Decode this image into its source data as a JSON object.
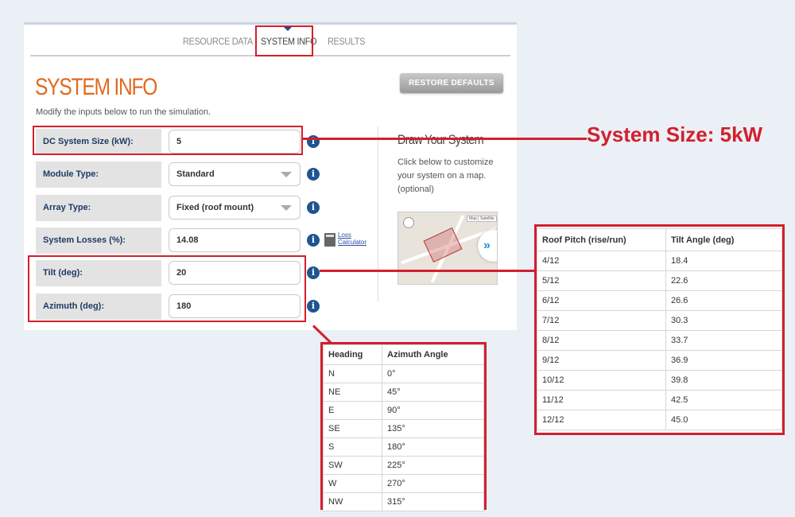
{
  "tabs": [
    "RESOURCE DATA",
    "SYSTEM INFO",
    "RESULTS"
  ],
  "title": "SYSTEM INFO",
  "subtitle": "Modify the inputs below to run the simulation.",
  "restore_button": "RESTORE DEFAULTS",
  "fields": {
    "dc_size": {
      "label": "DC System Size (kW):",
      "value": "5"
    },
    "module_type": {
      "label": "Module Type:",
      "value": "Standard"
    },
    "array_type": {
      "label": "Array Type:",
      "value": "Fixed (roof mount)"
    },
    "losses": {
      "label": "System Losses (%):",
      "value": "14.08"
    },
    "tilt": {
      "label": "Tilt (deg):",
      "value": "20"
    },
    "azimuth": {
      "label": "Azimuth (deg):",
      "value": "180"
    }
  },
  "info_glyph": "i",
  "loss_calc": {
    "line1": "Loss",
    "line2": "Calculator"
  },
  "draw": {
    "title": "Draw Your System",
    "desc": "Click below to customize your system on a map. (optional)",
    "map_pills": [
      "Map",
      "Satellite"
    ],
    "map_arrow": "»"
  },
  "callout": "System Size: 5kW",
  "azimuth_table": {
    "headers": [
      "Heading",
      "Azimuth Angle"
    ],
    "rows": [
      [
        "N",
        "0°"
      ],
      [
        "NE",
        "45°"
      ],
      [
        "E",
        "90°"
      ],
      [
        "SE",
        "135°"
      ],
      [
        "S",
        "180°"
      ],
      [
        "SW",
        "225°"
      ],
      [
        "W",
        "270°"
      ],
      [
        "NW",
        "315°"
      ]
    ]
  },
  "pitch_table": {
    "headers": [
      "Roof Pitch (rise/run)",
      "Tilt Angle (deg)"
    ],
    "rows": [
      [
        "4/12",
        "18.4"
      ],
      [
        "5/12",
        "22.6"
      ],
      [
        "6/12",
        "26.6"
      ],
      [
        "7/12",
        "30.3"
      ],
      [
        "8/12",
        "33.7"
      ],
      [
        "9/12",
        "36.9"
      ],
      [
        "10/12",
        "39.8"
      ],
      [
        "11/12",
        "42.5"
      ],
      [
        "12/12",
        "45.0"
      ]
    ]
  },
  "colors": {
    "accent_red": "#d31f2d",
    "title_orange": "#e06a1f",
    "label_blue": "#1f3a66",
    "info_blue": "#1f5590"
  }
}
